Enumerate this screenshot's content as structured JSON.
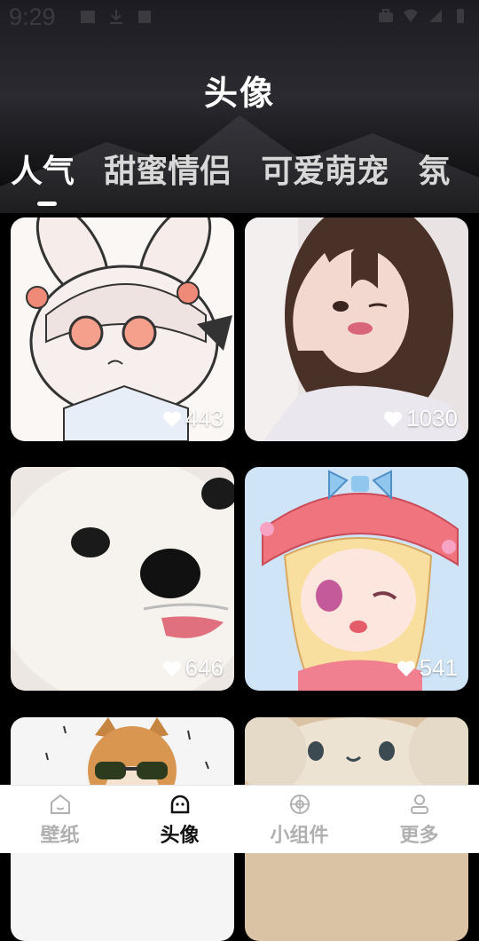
{
  "status_bar": {
    "time": "9:29"
  },
  "header": {
    "title": "头像"
  },
  "tabs": [
    {
      "label": "人气",
      "active": true
    },
    {
      "label": "甜蜜情侣",
      "active": false
    },
    {
      "label": "可爱萌宠",
      "active": false
    },
    {
      "label": "氛",
      "active": false
    }
  ],
  "cards": [
    {
      "subject": "anime-bunny-girl",
      "likes": "443"
    },
    {
      "subject": "girl-peace-sign",
      "likes": "1030"
    },
    {
      "subject": "white-puppy",
      "likes": "646"
    },
    {
      "subject": "anime-girl-bow",
      "likes": "541"
    },
    {
      "subject": "shiba-sunglasses",
      "likes": ""
    },
    {
      "subject": "plush-toy",
      "likes": ""
    }
  ],
  "bottom_nav": [
    {
      "label": "壁纸",
      "icon": "home-icon",
      "active": false
    },
    {
      "label": "头像",
      "icon": "avatar-icon",
      "active": true
    },
    {
      "label": "小组件",
      "icon": "widget-icon",
      "active": false
    },
    {
      "label": "更多",
      "icon": "profile-icon",
      "active": false
    }
  ],
  "colors": {
    "nav_active": "#111111",
    "nav_inactive": "#b0b0b0",
    "background": "#000000"
  }
}
